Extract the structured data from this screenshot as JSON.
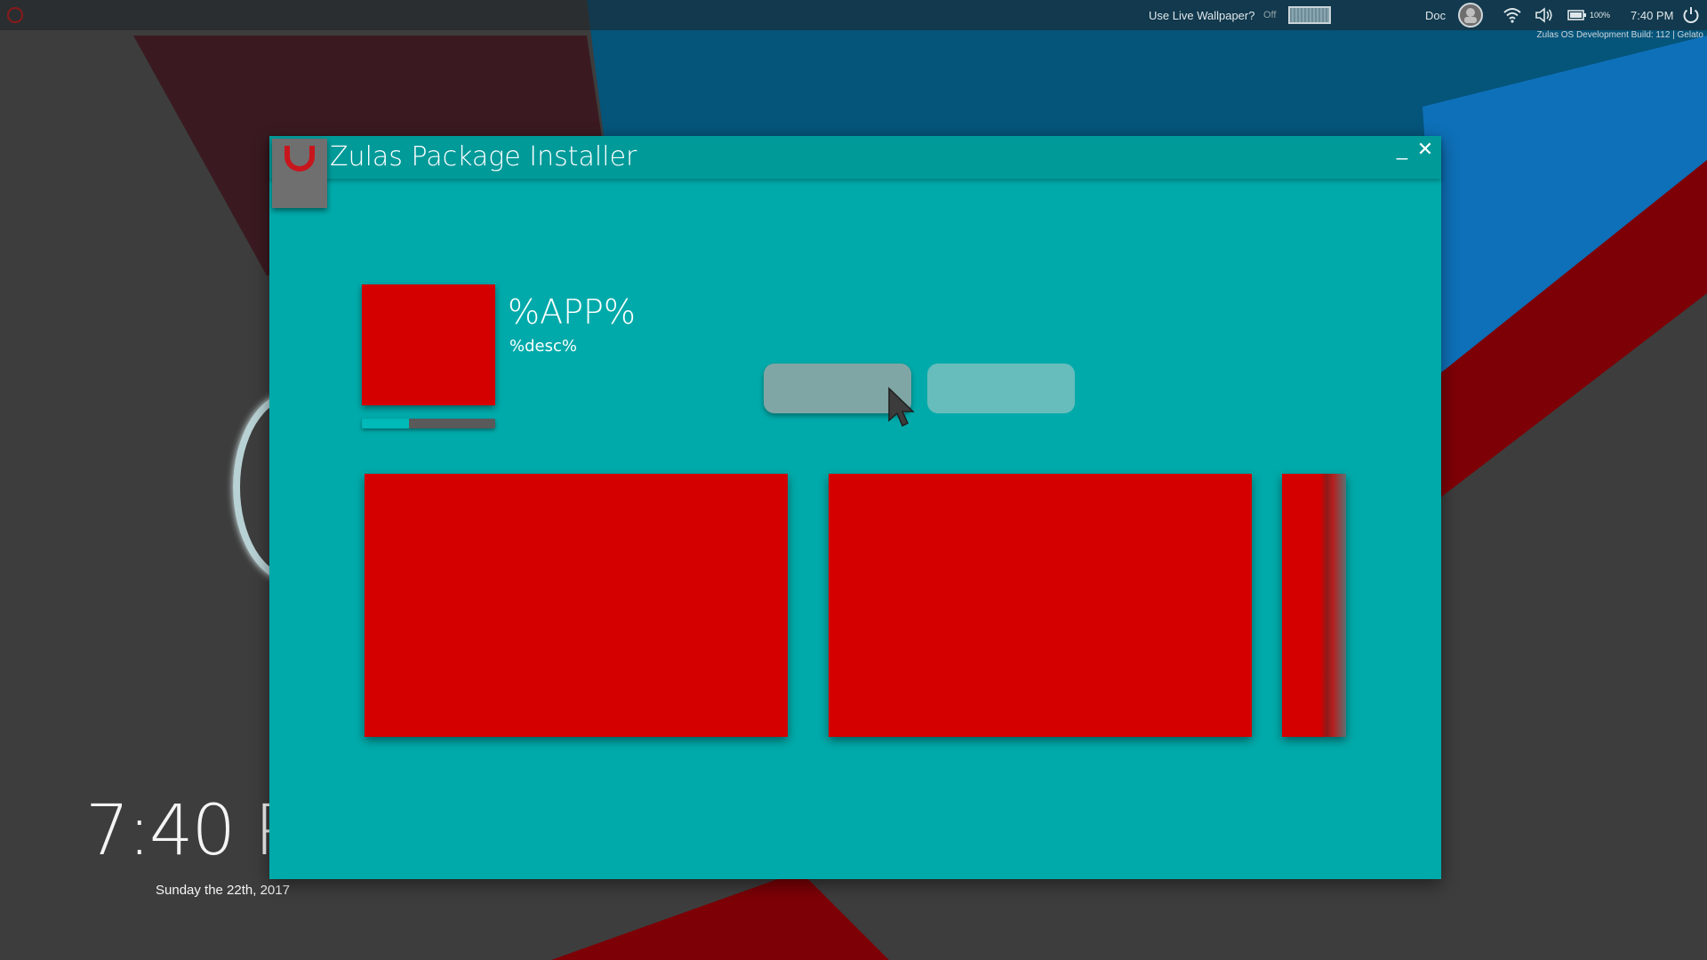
{
  "topbar": {
    "wallpaper_label": "Use Live Wallpaper?",
    "wallpaper_state": "Off",
    "doc_label": "Doc",
    "battery": "100%",
    "time": "7:40 PM"
  },
  "build_info": "Zulas OS Development Build: 112 | Gelato",
  "desktop": {
    "time": "7:40 P",
    "date": "Sunday the 22th, 2017"
  },
  "window": {
    "title": "Zulas Package Installer",
    "app_name": "%APP%",
    "app_desc": "%desc%",
    "progress": 0.35
  },
  "icons": {
    "logo": "u-logo-icon",
    "wifi": "wifi-icon",
    "volume": "volume-icon",
    "battery": "battery-icon",
    "power": "power-icon",
    "avatar": "avatar",
    "cursor": "cursor-icon",
    "minimize": "minimize-icon",
    "close": "close-icon"
  },
  "colors": {
    "window_bg": "#00aaaa",
    "titlebar": "#009a99",
    "placeholder_red": "#d40000",
    "install_button": "#7fa6a5",
    "cancel_button": "#66bdbb"
  }
}
